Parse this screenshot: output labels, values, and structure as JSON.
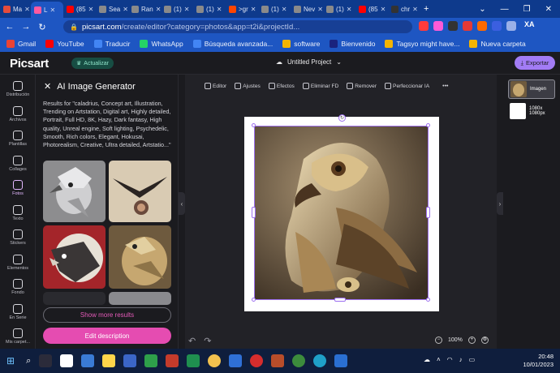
{
  "browser": {
    "tabs": [
      {
        "label": "Ma",
        "color": "#e54c3c"
      },
      {
        "label": "L",
        "color": "#ff5aa0",
        "active": true
      },
      {
        "label": "(85",
        "color": "#ff0000"
      },
      {
        "label": "Sea",
        "color": "#8a8a8a"
      },
      {
        "label": "Ran",
        "color": "#8a8a8a"
      },
      {
        "label": "(1)",
        "color": "#8a8a8a"
      },
      {
        "label": "(1)",
        "color": "#8a8a8a"
      },
      {
        "label": ">gr",
        "color": "#ff4500"
      },
      {
        "label": "(1)",
        "color": "#8a8a8a"
      },
      {
        "label": "Nev",
        "color": "#8a8a8a"
      },
      {
        "label": "(1)",
        "color": "#8a8a8a"
      },
      {
        "label": "(85",
        "color": "#ff0000"
      },
      {
        "label": "chr",
        "color": "#333333"
      }
    ],
    "url_host": "picsart.com",
    "url_path": "/create/editor?category=photos&app=t2i&projectId...",
    "bookmarks": [
      {
        "label": "Gmail",
        "color": "#ea4335"
      },
      {
        "label": "YouTube",
        "color": "#ff0000"
      },
      {
        "label": "Traducir",
        "color": "#4285f4"
      },
      {
        "label": "WhatsApp",
        "color": "#25d366"
      },
      {
        "label": "Búsqueda avanzada...",
        "color": "#4285f4"
      },
      {
        "label": "software",
        "color": "#f4b400"
      },
      {
        "label": "Bienvenido",
        "color": "#1a237e"
      },
      {
        "label": "Tagsyo might have...",
        "color": "#f4b400"
      },
      {
        "label": "Nueva carpeta",
        "color": "#f4b400"
      }
    ],
    "profile": "XA"
  },
  "app": {
    "logo": "Picsart",
    "upgrade": "Actualizar",
    "project_name": "Untitled Project",
    "export": "Exportar"
  },
  "rail": [
    {
      "label": "Distribución"
    },
    {
      "label": "Archivos"
    },
    {
      "label": "Plantillas"
    },
    {
      "label": "Collages"
    },
    {
      "label": "Fotos",
      "active": true
    },
    {
      "label": "Texto"
    },
    {
      "label": "Stickers"
    },
    {
      "label": "Elementos"
    },
    {
      "label": "Fondo"
    },
    {
      "label": "En Serie"
    },
    {
      "label": "Mis carpet..."
    }
  ],
  "panel": {
    "title": "AI Image Generator",
    "description": "Results for \"caladrius, Concept art, Illustration, Trending on Artstation, Digital art, Highly detailed, Portrait, Full HD, 8K, Hazy, Dark fantasy, High quality, Unreal engine, Soft lighting, Psychedelic, Smooth, Rich colors, Elegant, Hokusai, Photorealism, Creative, Ultra detailed, Artstatio...\"",
    "show_more": "Show more results",
    "edit": "Edit description"
  },
  "toolbar": [
    {
      "label": "Editor"
    },
    {
      "label": "Ajustes"
    },
    {
      "label": "Efectos"
    },
    {
      "label": "Eliminar FD"
    },
    {
      "label": "Remover"
    },
    {
      "label": "Perfeccionar IA"
    }
  ],
  "canvas": {
    "zoom": "100%"
  },
  "layers": [
    {
      "label": "Imagen"
    },
    {
      "label": "1080x 1080px"
    }
  ],
  "taskbar": {
    "time": "20:48",
    "date": "10/01/2023"
  }
}
